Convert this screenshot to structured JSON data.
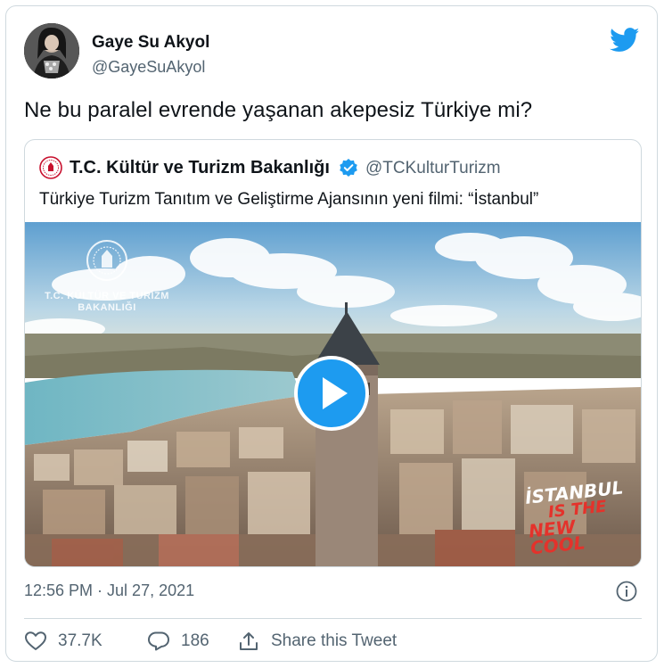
{
  "author": {
    "name": "Gaye Su Akyol",
    "handle": "@GayeSuAkyol"
  },
  "tweet": {
    "text": "Ne bu paralel evrende yaşanan akepesiz Türkiye mi?",
    "timestamp": "12:56 PM · Jul 27, 2021"
  },
  "quoted": {
    "name": "T.C. Kültür ve Turizm Bakanlığı",
    "handle": "@TCKulturTurizm",
    "text": "Türkiye Turizm Tanıtım ve Geliştirme Ajansının yeni filmi: “İstanbul”",
    "watermark": "T.C. KÜLTÜR VE TURİZM BAKANLIĞI",
    "slogan": {
      "line1": "İSTANBUL",
      "line2": "IS THE",
      "line3": "NEW COOL"
    }
  },
  "actions": {
    "likes": "37.7K",
    "replies": "186",
    "share_label": "Share this Tweet"
  },
  "colors": {
    "brand": "#1d9bf0",
    "text_primary": "#0f1419",
    "text_secondary": "#536471",
    "border": "#cfd9de",
    "slogan_red": "#e4322b"
  },
  "icons": [
    "twitter-bird-icon",
    "verified-badge-icon",
    "play-icon",
    "info-icon",
    "heart-icon",
    "reply-bubble-icon",
    "share-icon"
  ]
}
